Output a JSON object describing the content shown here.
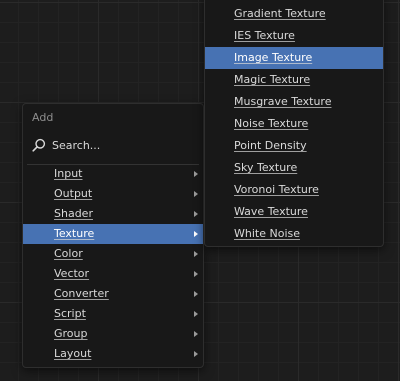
{
  "add_menu": {
    "title": "Add",
    "search": {
      "icon": "search-icon",
      "label": "Search..."
    },
    "items": [
      {
        "label": "Input",
        "has_submenu": true
      },
      {
        "label": "Output",
        "has_submenu": true
      },
      {
        "label": "Shader",
        "has_submenu": true
      },
      {
        "label": "Texture",
        "has_submenu": true,
        "active": true
      },
      {
        "label": "Color",
        "has_submenu": true
      },
      {
        "label": "Vector",
        "has_submenu": true
      },
      {
        "label": "Converter",
        "has_submenu": true
      },
      {
        "label": "Script",
        "has_submenu": true
      },
      {
        "label": "Group",
        "has_submenu": true
      },
      {
        "label": "Layout",
        "has_submenu": true
      }
    ]
  },
  "texture_submenu": {
    "items": [
      {
        "label": "Gradient Texture"
      },
      {
        "label": "IES Texture"
      },
      {
        "label": "Image Texture",
        "active": true
      },
      {
        "label": "Magic Texture"
      },
      {
        "label": "Musgrave Texture"
      },
      {
        "label": "Noise Texture"
      },
      {
        "label": "Point Density"
      },
      {
        "label": "Sky Texture"
      },
      {
        "label": "Voronoi Texture"
      },
      {
        "label": "Wave Texture"
      },
      {
        "label": "White Noise"
      }
    ]
  },
  "colors": {
    "highlight": "#4772b3",
    "menu_bg": "#181818",
    "canvas_bg": "#1d1d1d",
    "text": "#d9d9d9",
    "title_text": "#8d8d8d"
  }
}
